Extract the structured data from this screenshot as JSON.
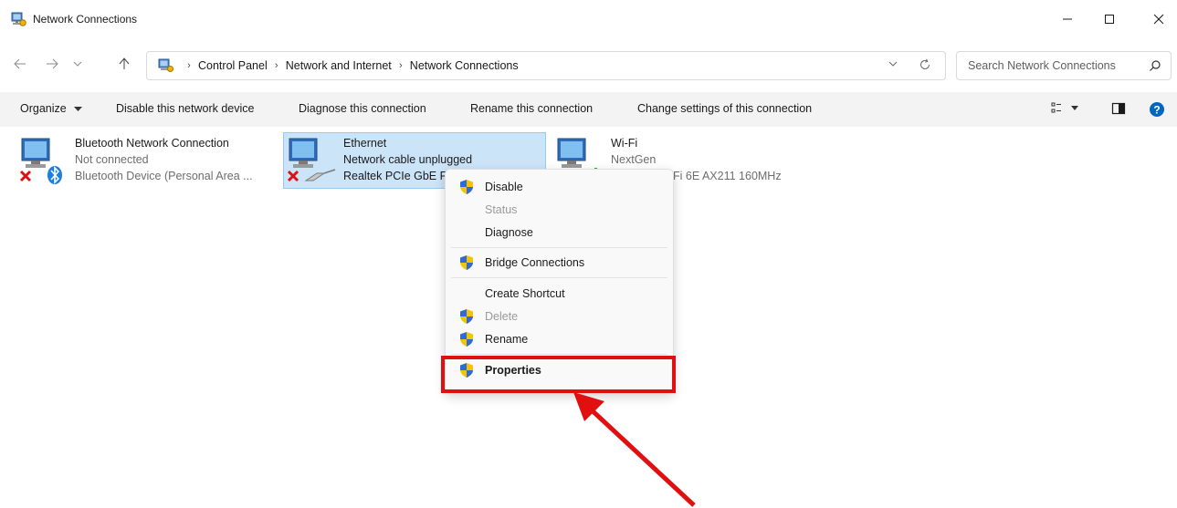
{
  "window": {
    "title": "Network Connections"
  },
  "address": {
    "crumbs": [
      "Control Panel",
      "Network and Internet",
      "Network Connections"
    ]
  },
  "search": {
    "placeholder": "Search Network Connections"
  },
  "toolbar": {
    "organize": "Organize",
    "disable": "Disable this network device",
    "diagnose": "Diagnose this connection",
    "rename": "Rename this connection",
    "change_settings": "Change settings of this connection"
  },
  "connections": [
    {
      "name": "Bluetooth Network Connection",
      "status": "Not connected",
      "device": "Bluetooth Device (Personal Area ..."
    },
    {
      "name": "Ethernet",
      "status": "Network cable unplugged",
      "device": "Realtek PCIe GbE F"
    },
    {
      "name": "Wi-Fi",
      "status": "NextGen",
      "device": "Fi 6E AX211 160MHz"
    }
  ],
  "context_menu": {
    "items": [
      {
        "label": "Disable",
        "shield": true,
        "disabled": false,
        "bold": false
      },
      {
        "label": "Status",
        "shield": false,
        "disabled": true,
        "bold": false
      },
      {
        "label": "Diagnose",
        "shield": false,
        "disabled": false,
        "bold": false
      },
      {
        "label": "Bridge Connections",
        "shield": true,
        "disabled": false,
        "bold": false
      },
      {
        "label": "Create Shortcut",
        "shield": false,
        "disabled": false,
        "bold": false
      },
      {
        "label": "Delete",
        "shield": true,
        "disabled": true,
        "bold": false
      },
      {
        "label": "Rename",
        "shield": true,
        "disabled": false,
        "bold": false
      },
      {
        "label": "Properties",
        "shield": true,
        "disabled": false,
        "bold": true
      }
    ]
  },
  "colors": {
    "selection_bg": "#cce4f7",
    "highlight": "#e01010",
    "help_blue": "#0067c0"
  }
}
